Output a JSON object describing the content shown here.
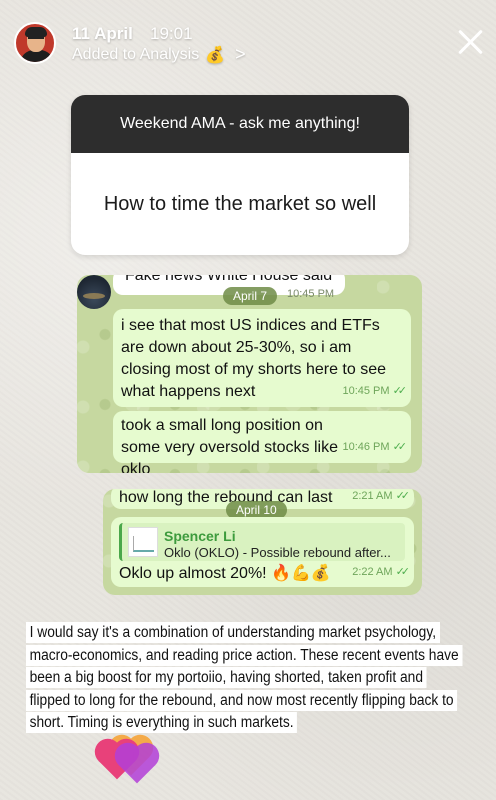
{
  "header": {
    "date": "11 April",
    "time": "19:01",
    "added_to": "Added to Analysis",
    "money_icon": "💰",
    "chevron": ">"
  },
  "question_sticker": {
    "title": "Weekend AMA - ask me anything!",
    "question": "How to time the market so well"
  },
  "chat1": {
    "cut_text": "Fake news White House said",
    "date_pill": "April 7",
    "cut_time": "10:45 PM",
    "messages": [
      {
        "text": "i see that most US indices and ETFs are down about 25-30%, so i am closing most of my shorts here to see what happens next",
        "time": "10:45 PM"
      },
      {
        "text": "took a small long position on some very oversold stocks like oklo",
        "time": "10:46 PM"
      }
    ]
  },
  "chat2": {
    "cut_text": "how long the rebound can last",
    "cut_time": "2:21 AM",
    "date_pill": "April 10",
    "reply": {
      "name": "Spencer Li",
      "preview": "Oklo (OKLO) - Possible rebound after..."
    },
    "message": "Oklo up almost 20%! 🔥💪💰",
    "time": "2:22 AM"
  },
  "answer": "I would say it's a combination of understanding market psychology, macro-economics, and reading price action. These recent events have been a big boost for my portoiio, having shorted, taken profit and flipped to long for the rebound, and now most recently flipping back to short. Timing is everything in such markets.",
  "colors": {
    "chat_bg": "#c6d8a0",
    "bubble": "#e6fbcf",
    "check": "#4fae4e"
  }
}
